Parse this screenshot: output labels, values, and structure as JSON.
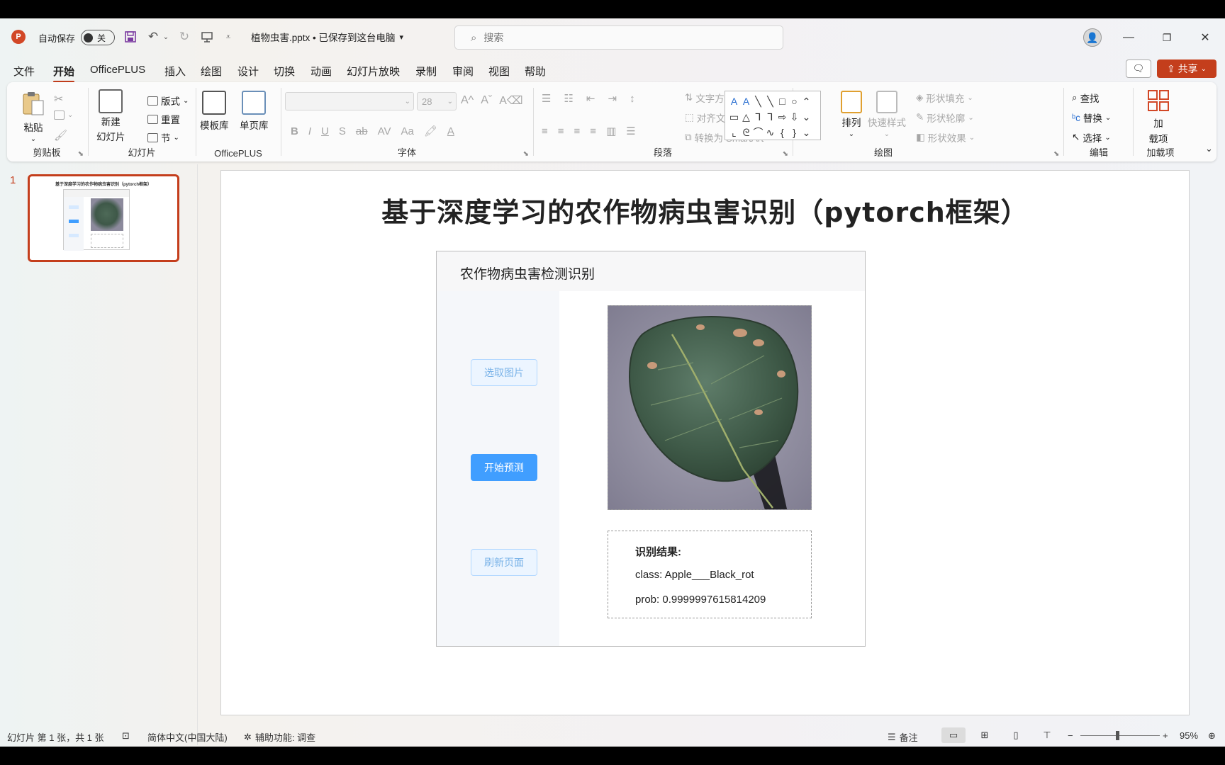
{
  "titlebar": {
    "app_logo": "P",
    "autosave_label": "自动保存",
    "autosave_state": "关",
    "filename": "植物虫害.pptx • 已保存到这台电脑",
    "search_placeholder": "搜索",
    "icons": [
      "save-icon",
      "undo-icon",
      "redo-icon",
      "present-from-start-icon",
      "customize-qat-icon"
    ]
  },
  "menu": {
    "tabs": [
      "文件",
      "开始",
      "OfficePLUS",
      "插入",
      "绘图",
      "设计",
      "切换",
      "动画",
      "幻灯片放映",
      "录制",
      "审阅",
      "视图",
      "帮助"
    ],
    "active_tab": "开始",
    "share_label": "共享"
  },
  "ribbon": {
    "clipboard": {
      "label": "剪贴板",
      "paste": "粘贴"
    },
    "slides": {
      "label": "幻灯片",
      "new_slide_1": "新建",
      "new_slide_2": "幻灯片",
      "layout": "版式",
      "reset": "重置",
      "section": "节"
    },
    "officeplus": {
      "label": "OfficePLUS",
      "templates": "模板库",
      "single_page": "单页库"
    },
    "font": {
      "label": "字体",
      "font_size": "28",
      "b": "B",
      "i": "I",
      "u": "U",
      "s": "S",
      "abc": "ab",
      "av": "AV",
      "aa": "Aa",
      "a": "A"
    },
    "paragraph": {
      "label": "段落",
      "text_direction": "文字方向",
      "align_text": "对齐文本",
      "smartart": "转换为 SmartArt"
    },
    "drawing": {
      "label": "绘图",
      "arrange": "排列",
      "quick_styles": "快速样式",
      "shape_fill": "形状填充",
      "shape_outline": "形状轮廓",
      "shape_effects": "形状效果"
    },
    "shapes": [
      "A",
      "A",
      "╲",
      "╲",
      "□",
      "○",
      "⌃",
      "▭",
      "△",
      "⅂",
      "⅂",
      "⇨",
      "⇩",
      "⌄",
      "⌞",
      "ᘓ",
      "⌒",
      "∿",
      "{",
      "}",
      "⌄"
    ],
    "editing": {
      "label": "编辑",
      "find": "查找",
      "replace": "替换",
      "select": "选择"
    },
    "addins": {
      "label": "加载项",
      "addin_1": "加",
      "addin_2": "载项"
    }
  },
  "thumbnail": {
    "number": "1",
    "title": "基于深度学习的农作物病虫害识别（pytorch框架）"
  },
  "slide": {
    "title": "基于深度学习的农作物病虫害识别（pytorch框架）",
    "app": {
      "header": "农作物病虫害检测识别",
      "btn_select": "选取图片",
      "btn_predict": "开始预测",
      "btn_refresh": "刷新页面",
      "result_title": "识别结果:",
      "result_class": "class: Apple___Black_rot",
      "result_prob": "prob: 0.9999997615814209"
    }
  },
  "statusbar": {
    "slide_info": "幻灯片 第 1 张，共 1 张",
    "language": "简体中文(中国大陆)",
    "accessibility": "辅助功能: 调查",
    "notes": "备注",
    "zoom": "95%"
  },
  "colors": {
    "accent": "#c43e1c",
    "primary_button": "#409eff",
    "plain_button_bg": "#ecf5ff"
  }
}
